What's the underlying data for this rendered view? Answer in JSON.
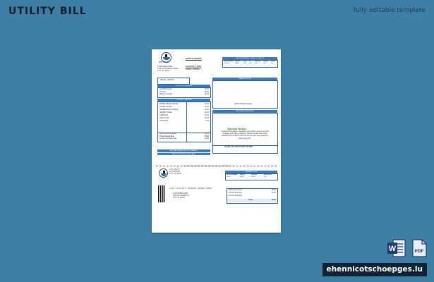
{
  "header": {
    "title": "UTILITY BILL",
    "subtitle": "fully editable template"
  },
  "colors": {
    "background": "#3f7fa6",
    "accent": "#3c79c0",
    "badge": "#0c2434"
  },
  "bill": {
    "company_name": "CITY UTILITY",
    "service_heading": "SERVICE ADDRESS",
    "account_label": "ACCOUNT # / DATE",
    "account_value": "000000 - 00/00/00",
    "customer_lines": [
      "CUSTOMER NAME",
      "1234 ANYWHERE STREET",
      "CITY, ST 00000"
    ],
    "meter_bar": "METER READINGS / SERVICE PERIOD",
    "meter_cols": [
      "METER NUMBER",
      "SERVICE",
      "FROM",
      "TO",
      "PREVIOUS",
      "PRESENT",
      "USAGE"
    ],
    "meter_row": [
      "00000000",
      "WATER",
      "00/00",
      "00/00",
      "00000",
      "00000",
      "000"
    ],
    "account_summary_bar": "ACCOUNT SUMMARY",
    "account_summary_rows": [
      {
        "label": "Last Bill Amount",
        "value": "00.00"
      },
      {
        "label": "Payment",
        "value": "-00.00"
      },
      {
        "label": "Balance Forward",
        "value": "00.00"
      }
    ],
    "current_charges_bar": "CURRENT CHARGES",
    "charge_rows": [
      {
        "label": "WATER BASE CHARGE",
        "value": "00.00"
      },
      {
        "label": "WATER USAGE",
        "value": "00.00"
      },
      {
        "label": "SEWER BASE CHARGE",
        "value": "00.00"
      },
      {
        "label": "SEWER USAGE",
        "value": "00.00"
      },
      {
        "label": "GARBAGE",
        "value": "00.00"
      },
      {
        "label": "RECYCLING",
        "value": "00.00"
      },
      {
        "label": "STATE TAX",
        "value": "0.00"
      }
    ],
    "total_rows": [
      {
        "label": "Total Current Charges",
        "value": "00.00"
      },
      {
        "label": "Total Amount Due",
        "value": "00.00"
      },
      {
        "label": "Amount Due After Date",
        "value": "00.00"
      }
    ],
    "usage_history_bar": "USAGE HISTORY",
    "usage_history_note": "VIEW USAGE ONLINE",
    "important_bar": "IMPORTANT MESSAGES",
    "special_notice_title": "Special Notice",
    "special_notice_text": "Important information regarding your utility account, service changes and billing practices. Please review this notice carefully and contact customer service with any questions about your bill.",
    "message_footer": "THANK YOU FOR PAYING ON TIME",
    "autopay_lines": [
      "AUTOPAY: ENROLL AT CITY WEBSITE",
      "PAPERLESS BILLING AVAILABLE"
    ],
    "stub_note": "PLEASE DETACH AND RETURN THIS PORTION WITH YOUR PAYMENT",
    "stub_address_lines": [
      "CITY UTILITY",
      "PO BOX 0000",
      "CITY, ST 00000"
    ],
    "stub_bar": "PAYMENT STUB",
    "stub_cols": [
      "ACCOUNT NUMBER",
      "SERVICE",
      "DUE DATE",
      "AMOUNT DUE"
    ],
    "stub_row": [
      "000000",
      "WATER",
      "00/00/00",
      "00.00"
    ],
    "stub_summary_rows": [
      {
        "label": "Total Amount Due",
        "value": "00.00"
      },
      {
        "label": "Amount Due After",
        "value": "00.00"
      },
      {
        "label": "Amount Enclosed",
        "value": ""
      }
    ],
    "stub_total_label": "Total",
    "stub_total_value": "00.00",
    "mail_code": "CITY UTILITY 000000 00000 0000",
    "recipient_lines": [
      "CUSTOMER NAME",
      "1234 ANYWHERE ST",
      "CITY, ST 00000"
    ]
  },
  "footer": {
    "site": "ehennicotschoepges.lu",
    "word_icon": "word-document-icon",
    "pdf_icon": "pdf-document-icon",
    "pdf_label": "PDF",
    "word_label": "W"
  }
}
